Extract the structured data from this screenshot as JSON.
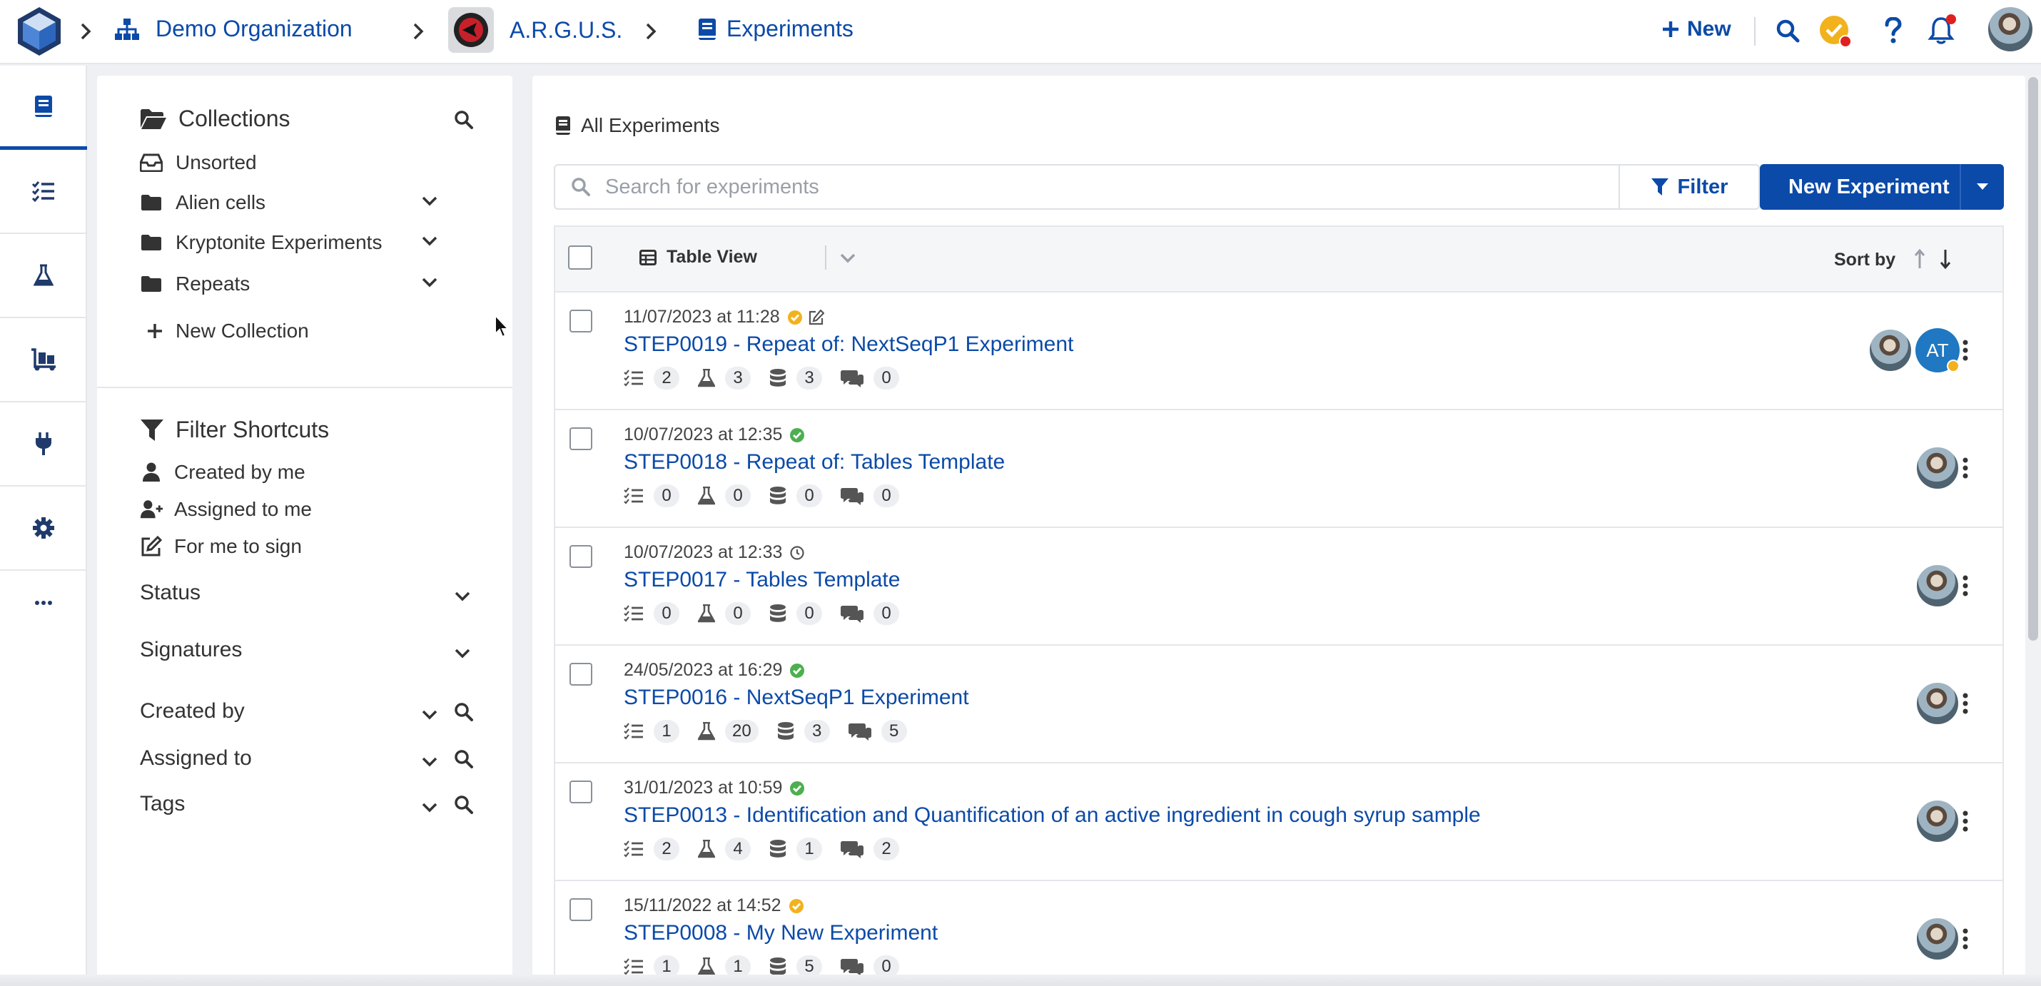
{
  "topbar": {
    "breadcrumbs": {
      "organization": "Demo Organization",
      "project": "A.R.G.U.S.",
      "section": "Experiments"
    },
    "new_label": "New"
  },
  "icons": {
    "logo": "cube-logo-icon",
    "org": "sitemap-icon",
    "book": "book-icon",
    "search": "search-icon",
    "help": "question-icon",
    "bell": "bell-icon"
  },
  "colors": {
    "accent": "#0b4aa8",
    "status_pending": "#f2b21e",
    "status_done": "#4caf50",
    "alert": "#e02020"
  },
  "sidebar": {
    "collections_title": "Collections",
    "collections": [
      {
        "label": "Unsorted"
      },
      {
        "label": "Alien cells"
      },
      {
        "label": "Kryptonite Experiments"
      },
      {
        "label": "Repeats"
      }
    ],
    "new_collection": "New Collection",
    "filter_title": "Filter Shortcuts",
    "shortcuts": [
      "Created by me",
      "Assigned to me",
      "For me to sign"
    ],
    "dropdowns": [
      "Status",
      "Signatures",
      "Created by",
      "Assigned to",
      "Tags"
    ]
  },
  "main": {
    "heading": "All Experiments",
    "search_placeholder": "Search for experiments",
    "filter_label": "Filter",
    "new_experiment_label": "New Experiment",
    "table_view_label": "Table View",
    "sort_label": "Sort by",
    "rows": [
      {
        "date": "11/07/2023 at 11:28",
        "status": "pending",
        "editing": true,
        "title": "STEP0019 - Repeat of: NextSeqP1 Experiment",
        "stats": [
          "2",
          "3",
          "3",
          "0"
        ],
        "assignee_initials": "AT"
      },
      {
        "date": "10/07/2023 at 12:35",
        "status": "done",
        "editing": false,
        "title": "STEP0018 - Repeat of: Tables Template",
        "stats": [
          "0",
          "0",
          "0",
          "0"
        ],
        "assignee_initials": ""
      },
      {
        "date": "10/07/2023 at 12:33",
        "status": "draft",
        "editing": false,
        "title": "STEP0017 - Tables Template",
        "stats": [
          "0",
          "0",
          "0",
          "0"
        ],
        "assignee_initials": ""
      },
      {
        "date": "24/05/2023 at 16:29",
        "status": "done",
        "editing": false,
        "title": "STEP0016 - NextSeqP1 Experiment",
        "stats": [
          "1",
          "20",
          "3",
          "5"
        ],
        "assignee_initials": ""
      },
      {
        "date": "31/01/2023 at 10:59",
        "status": "done",
        "editing": false,
        "title": "STEP0013 - Identification and Quantification of an active ingredient in cough syrup sample",
        "stats": [
          "2",
          "4",
          "1",
          "2"
        ],
        "assignee_initials": ""
      },
      {
        "date": "15/11/2022 at 14:52",
        "status": "pending",
        "editing": false,
        "title": "STEP0008 - My New Experiment",
        "stats": [
          "1",
          "1",
          "5",
          "0"
        ],
        "assignee_initials": ""
      }
    ]
  }
}
